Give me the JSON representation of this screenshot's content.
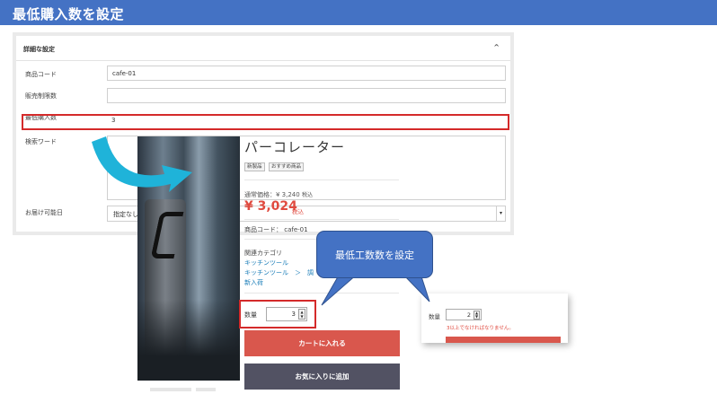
{
  "slide_title": "最低購入数を設定",
  "admin": {
    "section_title": "詳細な設定",
    "collapse_glyph": "^",
    "rows": [
      {
        "label": "商品コード",
        "value": ""
      },
      {
        "label": "販売制限数",
        "value": ""
      },
      {
        "label": "最低購入数",
        "value": ""
      },
      {
        "label": "検索ワード",
        "value": ""
      },
      {
        "label": "お届け可能日",
        "value": ""
      }
    ],
    "values": {
      "product_code": "cafe-01",
      "sales_limit": "",
      "min_purchase": "3",
      "delivery": "指定なし"
    }
  },
  "product": {
    "name": "パーコレーター",
    "tags": [
      "新製品",
      "おすすめ商品"
    ],
    "regular_price": "通常価格：¥ 3,240",
    "regular_tax": "税込",
    "sale_price": "¥ 3,024",
    "sale_tax": "税込",
    "code": "商品コード： cafe-01",
    "category_label": "関連カテゴリ",
    "categories": [
      "キッチンツール",
      "キッチンツール　＞　調",
      "新入荷"
    ],
    "qty_label": "数量",
    "qty_value": "3",
    "cart_button": "カートに入れる",
    "fav_button": "お気に入りに追加"
  },
  "error_popup": {
    "qty_label": "数量",
    "qty_value": "2",
    "message": "3以上でなければなりません。"
  },
  "callout": "最低工数数を設定",
  "colors": {
    "title_bar": "#4472c4",
    "highlight": "#d42a2a",
    "price": "#e04a3f",
    "link": "#1a7db8",
    "cart": "#d9574d",
    "fav": "#525263",
    "arrow": "#1fb3d9"
  }
}
